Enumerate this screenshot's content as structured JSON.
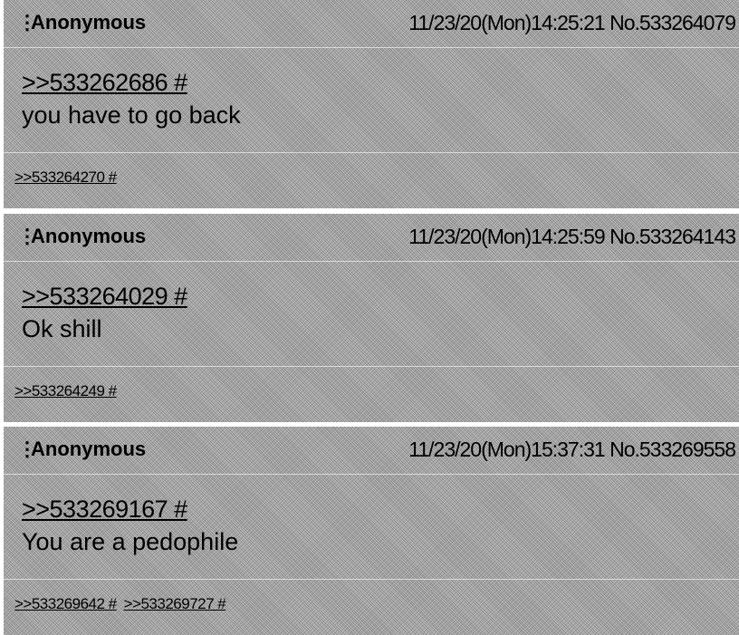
{
  "posts": [
    {
      "menu": "⋮",
      "name": "Anonymous",
      "datetime": "11/23/20(Mon)14:25:21",
      "number": "No.533264079",
      "quote": ">>533262686 #",
      "body": "you have to go back",
      "backlinks": [
        ">>533264270 #"
      ]
    },
    {
      "menu": "⋮",
      "name": "Anonymous",
      "datetime": "11/23/20(Mon)14:25:59",
      "number": "No.533264143",
      "quote": ">>533264029 #",
      "body": "Ok shill",
      "backlinks": [
        ">>533264249 #"
      ]
    },
    {
      "menu": "⋮",
      "name": "Anonymous",
      "datetime": "11/23/20(Mon)15:37:31",
      "number": "No.533269558",
      "quote": ">>533269167 #",
      "body": "You are a pedophile",
      "backlinks": [
        ">>533269642 #",
        ">>533269727 #"
      ]
    }
  ]
}
